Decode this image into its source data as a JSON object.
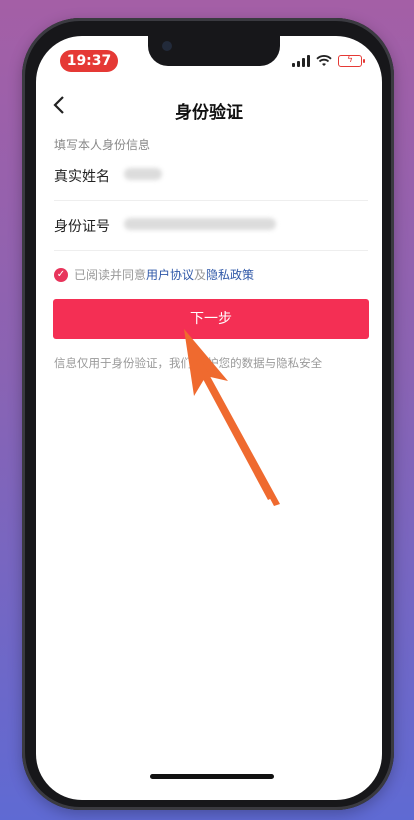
{
  "status_bar": {
    "time": "19:37"
  },
  "nav": {
    "back_icon": "chevron-left-icon",
    "title": "身份验证"
  },
  "form": {
    "section_label": "填写本人身份信息",
    "fields": [
      {
        "label": "真实姓名"
      },
      {
        "label": "身份证号"
      }
    ]
  },
  "agreement": {
    "prefix": "已阅读并同意",
    "user_agreement": "用户协议",
    "connector": "及",
    "privacy_policy": "隐私政策"
  },
  "next_button": {
    "label": "下一步"
  },
  "footer_note": "信息仅用于身份验证，我们将   护您的数据与隐私安全",
  "colors": {
    "primary": "#f42f54",
    "link": "#2f58a8",
    "arrow": "#ef6a2f",
    "time_pill": "#e53935"
  }
}
